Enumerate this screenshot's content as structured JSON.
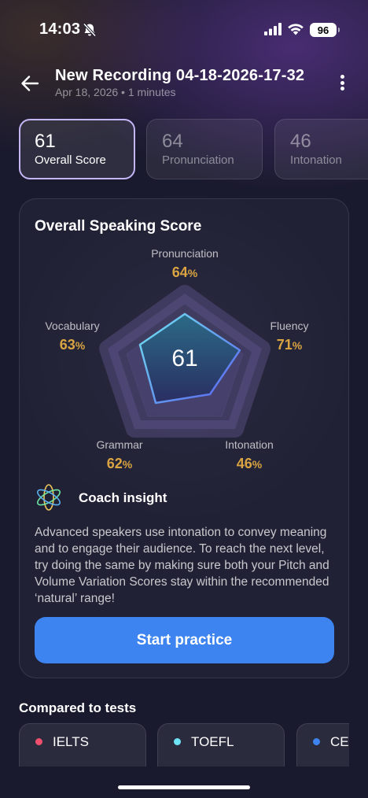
{
  "status_bar": {
    "time": "14:03",
    "battery": "96"
  },
  "header": {
    "title": "New Recording 04-18-2026-17-32",
    "subtitle": "Apr 18, 2026 • 1 minutes"
  },
  "score_tabs": [
    {
      "score": "61",
      "label": "Overall Score",
      "active": true
    },
    {
      "score": "64",
      "label": "Pronunciation",
      "active": false
    },
    {
      "score": "46",
      "label": "Intonation",
      "active": false
    }
  ],
  "card": {
    "title": "Overall Speaking Score",
    "overall": "61",
    "metrics": {
      "pronunciation": {
        "label": "Pronunciation",
        "value": "64",
        "unit": "%"
      },
      "fluency": {
        "label": "Fluency",
        "value": "71",
        "unit": "%"
      },
      "intonation": {
        "label": "Intonation",
        "value": "46",
        "unit": "%"
      },
      "grammar": {
        "label": "Grammar",
        "value": "62",
        "unit": "%"
      },
      "vocabulary": {
        "label": "Vocabulary",
        "value": "63",
        "unit": "%"
      }
    },
    "insight_title": "Coach insight",
    "insight_text": "Advanced speakers use intonation to convey meaning and to engage their audience. To reach the next level, try doing the same by making sure both your Pitch and Volume Variation Scores stay within the recommended ‘natural’ range!",
    "practice_button": "Start practice"
  },
  "compared": {
    "title": "Compared to tests",
    "tests": [
      {
        "label": "IELTS",
        "dot_color": "#f0506e"
      },
      {
        "label": "TOEFL",
        "dot_color": "#6ee3f5"
      },
      {
        "label": "CEFR",
        "dot_color": "#3d84f0"
      }
    ]
  },
  "colors": {
    "accent_blue": "#3d84f0",
    "score_gold": "#d9a441",
    "active_tab_border": "#c4b6f5"
  }
}
